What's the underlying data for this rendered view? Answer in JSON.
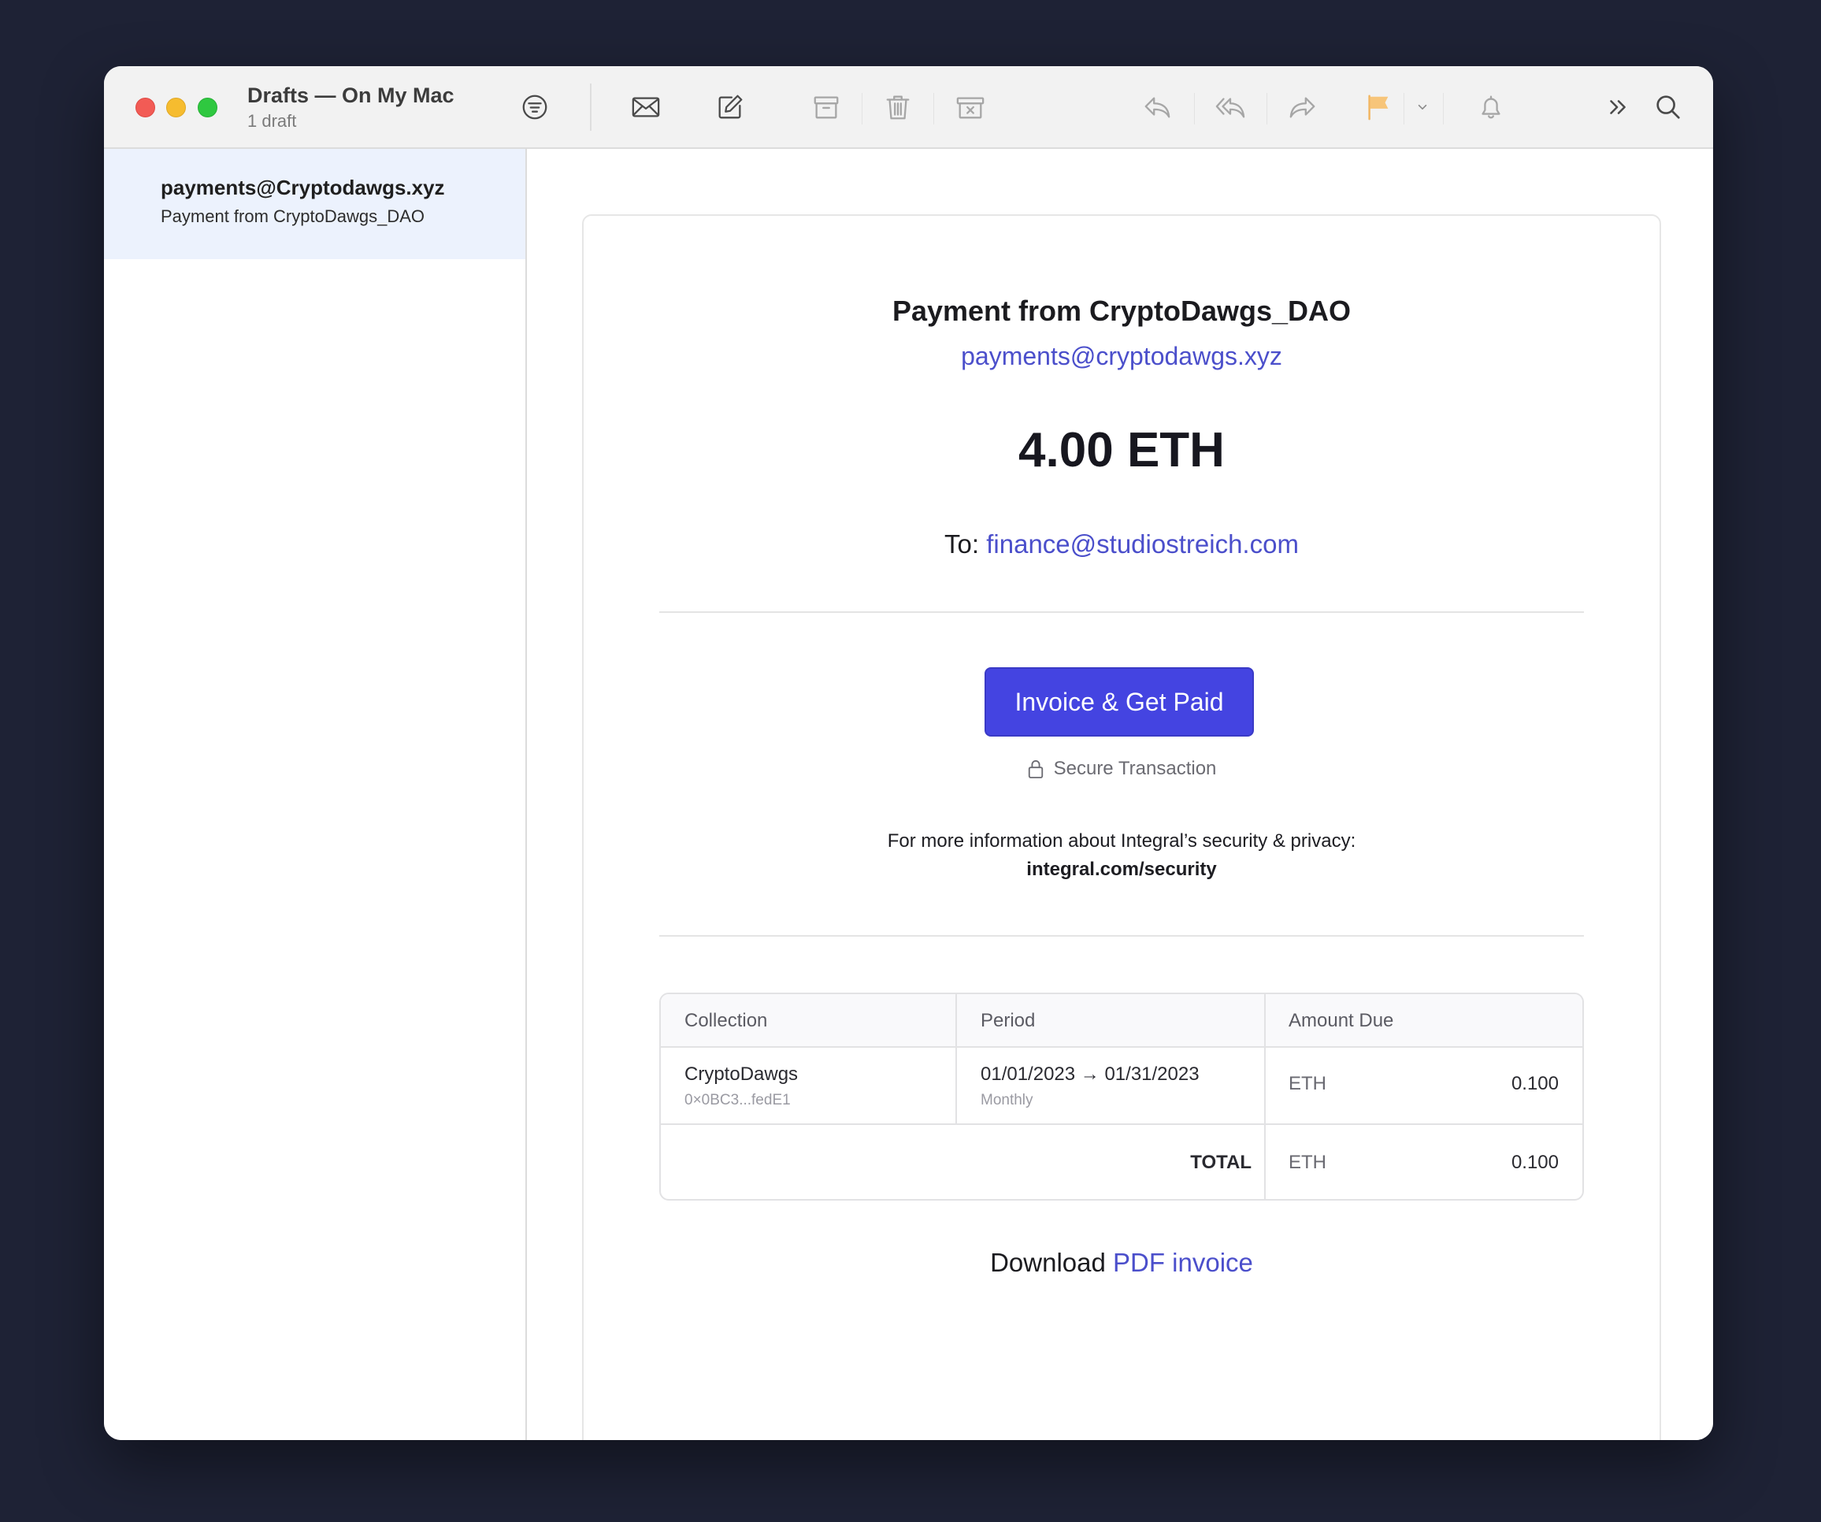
{
  "window": {
    "title": "Drafts — On My Mac",
    "subtitle": "1 draft"
  },
  "toolbar": {
    "icons": [
      "filter-icon",
      "envelope-icon",
      "compose-icon",
      "archive-icon",
      "trash-icon",
      "junk-icon",
      "reply-icon",
      "reply-all-icon",
      "forward-icon",
      "flag-icon",
      "chevron-down-icon",
      "bell-icon",
      "more-icon",
      "search-icon"
    ],
    "flag_color": "#f7c57a"
  },
  "sidebar": {
    "items": [
      {
        "from": "payments@Cryptodawgs.xyz",
        "subject": "Payment from CryptoDawgs_DAO"
      }
    ]
  },
  "email": {
    "title": "Payment from CryptoDawgs_DAO",
    "sender_email": "payments@cryptodawgs.xyz",
    "amount": "4.00 ETH",
    "to_label": "To: ",
    "to_email": "finance@studiostreich.com",
    "cta_label": "Invoice & Get Paid",
    "secure_label": "Secure Transaction",
    "info_text": "For more information about Integral’s security & privacy:",
    "info_link": "integral.com/security",
    "download_label": "Download ",
    "download_link": "PDF invoice",
    "accent_color": "#4444e1",
    "link_color": "#4b4fcb"
  },
  "table": {
    "headers": [
      "Collection",
      "Period",
      "Amount Due"
    ],
    "rows": [
      {
        "collection": "CryptoDawgs",
        "address": "0×0BC3...fedE1",
        "period": "01/01/2023 → 01/31/2023",
        "frequency": "Monthly",
        "unit": "ETH",
        "amount": "0.100"
      }
    ],
    "total_label": "TOTAL",
    "total_unit": "ETH",
    "total_amount": "0.100"
  }
}
